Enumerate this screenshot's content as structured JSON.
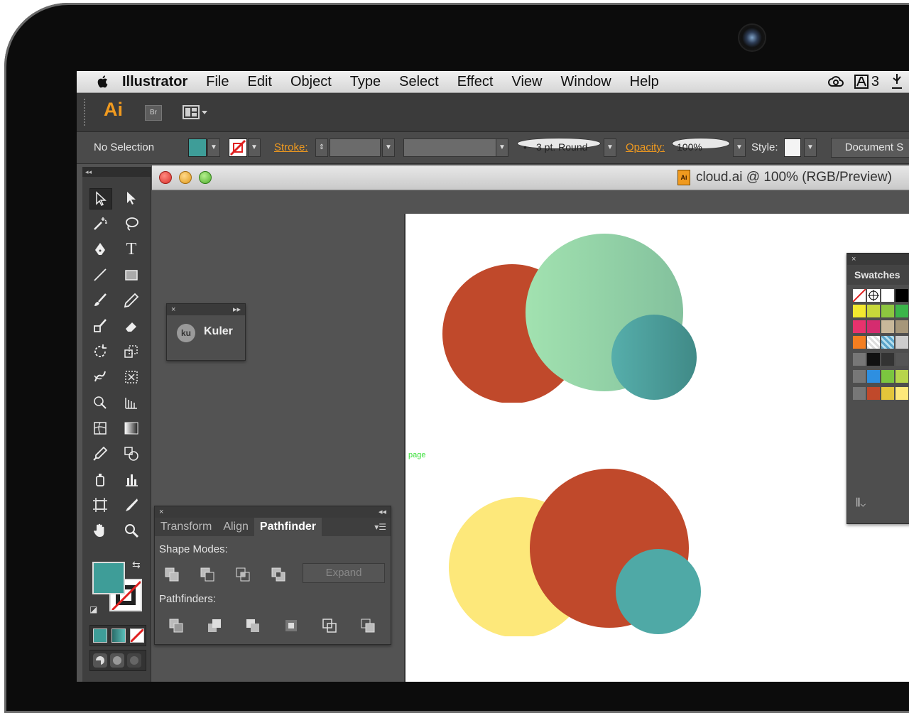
{
  "menubar": {
    "app_name": "Illustrator",
    "items": [
      "File",
      "Edit",
      "Object",
      "Type",
      "Select",
      "Effect",
      "View",
      "Window",
      "Help"
    ],
    "right_number": "3"
  },
  "appbar": {
    "logo_text": "Ai",
    "bridge_label": "Br"
  },
  "control_bar": {
    "selection_label": "No Selection",
    "fill_color": "#3e9d98",
    "stroke_label": "Stroke:",
    "brush_value": "3 pt. Round",
    "opacity_label": "Opacity:",
    "opacity_value": "100%",
    "style_label": "Style:",
    "document_setup_label": "Document S"
  },
  "document": {
    "title": "cloud.ai @ 100% (RGB/Preview)",
    "file_icon_text": "Ai",
    "artboard_label": "page"
  },
  "kuler_panel": {
    "icon_text": "ku",
    "label": "Kuler"
  },
  "pathfinder_panel": {
    "tabs": [
      {
        "label": "Transform",
        "active": false
      },
      {
        "label": "Align",
        "active": false
      },
      {
        "label": "Pathfinder",
        "active": true
      }
    ],
    "shape_modes_label": "Shape Modes:",
    "expand_label": "Expand",
    "pathfinders_label": "Pathfinders:"
  },
  "swatches_panel": {
    "title": "Swatches"
  },
  "colors": {
    "teal": "#4fa9a6",
    "rust": "#c0492b",
    "mint_light": "#a2e2b0",
    "mint_dark": "#83c19d",
    "yellow": "#fde87a",
    "accent_orange": "#f09a1f"
  }
}
